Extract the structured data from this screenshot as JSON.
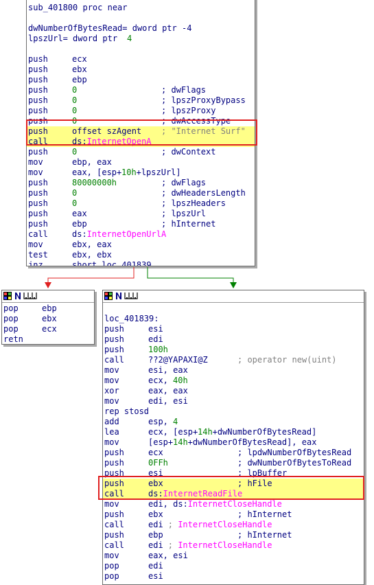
{
  "block_main": {
    "lines": [
      {
        "type": "label",
        "text": "sub_401800 proc near"
      },
      {
        "type": "blank"
      },
      {
        "type": "label",
        "text": "dwNumberOfBytesRead= dword ptr -4"
      },
      {
        "type": "label",
        "parts": [
          {
            "t": "lpszUrl= dword ptr  ",
            "c": "mn"
          },
          {
            "t": "4",
            "c": "nm"
          }
        ]
      },
      {
        "type": "blank"
      },
      {
        "type": "instr",
        "m": "push",
        "ops": [
          {
            "t": "ecx",
            "c": "mn"
          }
        ]
      },
      {
        "type": "instr",
        "m": "push",
        "ops": [
          {
            "t": "ebx",
            "c": "mn"
          }
        ]
      },
      {
        "type": "instr",
        "m": "push",
        "ops": [
          {
            "t": "ebp",
            "c": "mn"
          }
        ]
      },
      {
        "type": "instr",
        "m": "push",
        "ops": [
          {
            "t": "0",
            "c": "nm"
          }
        ],
        "cmt": [
          {
            "t": "; dwFlags",
            "c": "mn"
          }
        ]
      },
      {
        "type": "instr",
        "m": "push",
        "ops": [
          {
            "t": "0",
            "c": "nm"
          }
        ],
        "cmt": [
          {
            "t": "; lpszProxyBypass",
            "c": "mn"
          }
        ]
      },
      {
        "type": "instr",
        "m": "push",
        "ops": [
          {
            "t": "0",
            "c": "nm"
          }
        ],
        "cmt": [
          {
            "t": "; lpszProxy",
            "c": "mn"
          }
        ]
      },
      {
        "type": "instr",
        "m": "push",
        "ops": [
          {
            "t": "0",
            "c": "nm"
          }
        ],
        "cmt": [
          {
            "t": "; dwAccessType",
            "c": "mn"
          }
        ]
      },
      {
        "type": "instr",
        "m": "push",
        "hl": true,
        "ops": [
          {
            "t": "offset szAgent",
            "c": "mn"
          }
        ],
        "cmt": [
          {
            "t": "; \"Internet Surf\"",
            "c": "cm"
          }
        ]
      },
      {
        "type": "instr",
        "m": "call",
        "hl": true,
        "ops": [
          {
            "t": "ds:",
            "c": "mn"
          },
          {
            "t": "InternetOpenA",
            "c": "fn"
          }
        ]
      },
      {
        "type": "instr",
        "m": "push",
        "ops": [
          {
            "t": "0",
            "c": "nm"
          }
        ],
        "cmt": [
          {
            "t": "; dwContext",
            "c": "mn"
          }
        ]
      },
      {
        "type": "instr",
        "m": "mov",
        "ops": [
          {
            "t": "ebp, eax",
            "c": "mn"
          }
        ]
      },
      {
        "type": "instr",
        "m": "mov",
        "ops": [
          {
            "t": "eax, [esp+",
            "c": "mn"
          },
          {
            "t": "10h",
            "c": "nm"
          },
          {
            "t": "+lpszUrl]",
            "c": "mn"
          }
        ]
      },
      {
        "type": "instr",
        "m": "push",
        "ops": [
          {
            "t": "80000000h",
            "c": "nm"
          }
        ],
        "cmt": [
          {
            "t": "; dwFlags",
            "c": "mn"
          }
        ]
      },
      {
        "type": "instr",
        "m": "push",
        "ops": [
          {
            "t": "0",
            "c": "nm"
          }
        ],
        "cmt": [
          {
            "t": "; dwHeadersLength",
            "c": "mn"
          }
        ]
      },
      {
        "type": "instr",
        "m": "push",
        "ops": [
          {
            "t": "0",
            "c": "nm"
          }
        ],
        "cmt": [
          {
            "t": "; lpszHeaders",
            "c": "mn"
          }
        ]
      },
      {
        "type": "instr",
        "m": "push",
        "ops": [
          {
            "t": "eax",
            "c": "mn"
          }
        ],
        "cmt": [
          {
            "t": "; lpszUrl",
            "c": "mn"
          }
        ]
      },
      {
        "type": "instr",
        "m": "push",
        "ops": [
          {
            "t": "ebp",
            "c": "mn"
          }
        ],
        "cmt": [
          {
            "t": "; hInternet",
            "c": "mn"
          }
        ]
      },
      {
        "type": "instr",
        "m": "call",
        "ops": [
          {
            "t": "ds:",
            "c": "mn"
          },
          {
            "t": "InternetOpenUrlA",
            "c": "fn"
          }
        ]
      },
      {
        "type": "instr",
        "m": "mov",
        "ops": [
          {
            "t": "ebx, eax",
            "c": "mn"
          }
        ]
      },
      {
        "type": "instr",
        "m": "test",
        "ops": [
          {
            "t": "ebx, ebx",
            "c": "mn"
          }
        ]
      },
      {
        "type": "instr",
        "m": "jnz",
        "ops": [
          {
            "t": "short loc_401839",
            "c": "mn"
          }
        ]
      }
    ]
  },
  "block_left": {
    "lines": [
      {
        "type": "instr",
        "m": "pop",
        "ops": [
          {
            "t": "ebp",
            "c": "mn"
          }
        ]
      },
      {
        "type": "instr",
        "m": "pop",
        "ops": [
          {
            "t": "ebx",
            "c": "mn"
          }
        ]
      },
      {
        "type": "instr",
        "m": "pop",
        "ops": [
          {
            "t": "ecx",
            "c": "mn"
          }
        ]
      },
      {
        "type": "instr",
        "m": "retn",
        "ops": []
      }
    ]
  },
  "block_right": {
    "lines": [
      {
        "type": "blank"
      },
      {
        "type": "label",
        "text": "loc_401839:"
      },
      {
        "type": "instr",
        "m": "push",
        "ops": [
          {
            "t": "esi",
            "c": "mn"
          }
        ]
      },
      {
        "type": "instr",
        "m": "push",
        "ops": [
          {
            "t": "edi",
            "c": "mn"
          }
        ]
      },
      {
        "type": "instr",
        "m": "push",
        "ops": [
          {
            "t": "100h",
            "c": "nm"
          }
        ]
      },
      {
        "type": "instr",
        "m": "call",
        "ops": [
          {
            "t": "??2@YAPAXI@Z",
            "c": "mn"
          }
        ],
        "cmt": [
          {
            "t": "; operator new(uint)",
            "c": "cm"
          }
        ]
      },
      {
        "type": "instr",
        "m": "mov",
        "ops": [
          {
            "t": "esi, eax",
            "c": "mn"
          }
        ]
      },
      {
        "type": "instr",
        "m": "mov",
        "ops": [
          {
            "t": "ecx, ",
            "c": "mn"
          },
          {
            "t": "40h",
            "c": "nm"
          }
        ]
      },
      {
        "type": "instr",
        "m": "xor",
        "ops": [
          {
            "t": "eax, eax",
            "c": "mn"
          }
        ]
      },
      {
        "type": "instr",
        "m": "mov",
        "ops": [
          {
            "t": "edi, esi",
            "c": "mn"
          }
        ]
      },
      {
        "type": "label",
        "text": "rep stosd"
      },
      {
        "type": "instr",
        "m": "add",
        "ops": [
          {
            "t": "esp, ",
            "c": "mn"
          },
          {
            "t": "4",
            "c": "nm"
          }
        ]
      },
      {
        "type": "instr",
        "m": "lea",
        "ops": [
          {
            "t": "ecx, [esp+",
            "c": "mn"
          },
          {
            "t": "14h",
            "c": "nm"
          },
          {
            "t": "+dwNumberOfBytesRead]",
            "c": "mn"
          }
        ]
      },
      {
        "type": "instr",
        "m": "mov",
        "ops": [
          {
            "t": "[esp+",
            "c": "mn"
          },
          {
            "t": "14h",
            "c": "nm"
          },
          {
            "t": "+dwNumberOfBytesRead], eax",
            "c": "mn"
          }
        ]
      },
      {
        "type": "instr",
        "m": "push",
        "ops": [
          {
            "t": "ecx",
            "c": "mn"
          }
        ],
        "cmt": [
          {
            "t": "; lpdwNumberOfBytesRead",
            "c": "mn"
          }
        ]
      },
      {
        "type": "instr",
        "m": "push",
        "ops": [
          {
            "t": "0FFh",
            "c": "nm"
          }
        ],
        "cmt": [
          {
            "t": "; dwNumberOfBytesToRead",
            "c": "mn"
          }
        ]
      },
      {
        "type": "instr",
        "m": "push",
        "ops": [
          {
            "t": "esi",
            "c": "mn"
          }
        ],
        "cmt": [
          {
            "t": "; lpBuffer",
            "c": "mn"
          }
        ]
      },
      {
        "type": "instr",
        "m": "push",
        "hl": true,
        "ops": [
          {
            "t": "ebx",
            "c": "mn"
          }
        ],
        "cmt": [
          {
            "t": "; hFile",
            "c": "mn"
          }
        ]
      },
      {
        "type": "instr",
        "m": "call",
        "hl": true,
        "ops": [
          {
            "t": "ds:",
            "c": "mn"
          },
          {
            "t": "InternetReadFile",
            "c": "fn"
          }
        ]
      },
      {
        "type": "instr",
        "m": "mov",
        "ops": [
          {
            "t": "edi, ds:",
            "c": "mn"
          },
          {
            "t": "InternetCloseHandle",
            "c": "fn"
          }
        ]
      },
      {
        "type": "instr",
        "m": "push",
        "ops": [
          {
            "t": "ebx",
            "c": "mn"
          }
        ],
        "cmt": [
          {
            "t": "; hInternet",
            "c": "mn"
          }
        ]
      },
      {
        "type": "instr",
        "m": "call",
        "ops": [
          {
            "t": "edi",
            "c": "mn"
          }
        ],
        "cmtcol": "narrow",
        "cmt": [
          {
            "t": "; ",
            "c": "cm"
          },
          {
            "t": "InternetCloseHandle",
            "c": "fn"
          }
        ]
      },
      {
        "type": "instr",
        "m": "push",
        "ops": [
          {
            "t": "ebp",
            "c": "mn"
          }
        ],
        "cmt": [
          {
            "t": "; hInternet",
            "c": "mn"
          }
        ]
      },
      {
        "type": "instr",
        "m": "call",
        "ops": [
          {
            "t": "edi",
            "c": "mn"
          }
        ],
        "cmtcol": "narrow",
        "cmt": [
          {
            "t": "; ",
            "c": "cm"
          },
          {
            "t": "InternetCloseHandle",
            "c": "fn"
          }
        ]
      },
      {
        "type": "instr",
        "m": "mov",
        "ops": [
          {
            "t": "eax, esi",
            "c": "mn"
          }
        ]
      },
      {
        "type": "instr",
        "m": "pop",
        "ops": [
          {
            "t": "edi",
            "c": "mn"
          }
        ]
      },
      {
        "type": "instr",
        "m": "pop",
        "ops": [
          {
            "t": "esi",
            "c": "mn"
          }
        ]
      }
    ]
  },
  "colors": {
    "mnemonic": "#000080",
    "number": "#008000",
    "function": "#ff00ff",
    "comment": "#808080",
    "highlight": "#ffff88",
    "highlight_border": "#e02020",
    "edge_false": "#e02020",
    "edge_true": "#008000"
  }
}
